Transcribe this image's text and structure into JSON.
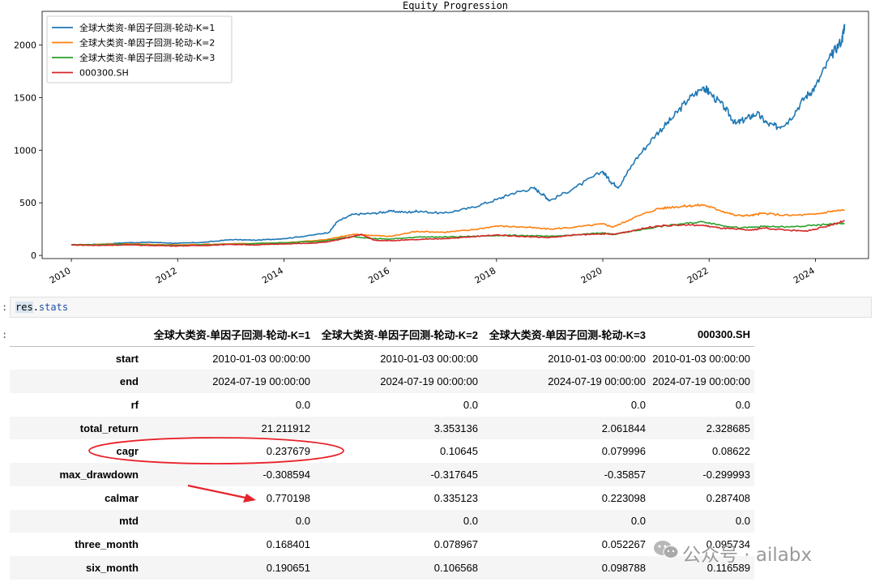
{
  "chart_data": {
    "type": "line",
    "title": "Equity Progression",
    "xlim": [
      2009.45,
      2025.0
    ],
    "ylim": [
      -30,
      2320
    ],
    "yticks": [
      0,
      500,
      1000,
      1500,
      2000
    ],
    "xticks": [
      2010,
      2012,
      2014,
      2016,
      2018,
      2020,
      2022,
      2024
    ],
    "legend": "top-left",
    "grid": false,
    "series": [
      {
        "name": "全球大类资-单因子回测-轮动-K=1",
        "color": "#1f77b4",
        "points": [
          [
            2010.0,
            100
          ],
          [
            2010.5,
            105
          ],
          [
            2011.0,
            120
          ],
          [
            2011.5,
            125
          ],
          [
            2012.0,
            115
          ],
          [
            2012.5,
            125
          ],
          [
            2013.0,
            150
          ],
          [
            2013.5,
            145
          ],
          [
            2014.0,
            160
          ],
          [
            2014.5,
            190
          ],
          [
            2014.85,
            220
          ],
          [
            2015.0,
            320
          ],
          [
            2015.3,
            390
          ],
          [
            2015.7,
            400
          ],
          [
            2016.0,
            420
          ],
          [
            2016.3,
            410
          ],
          [
            2016.5,
            420
          ],
          [
            2017.0,
            400
          ],
          [
            2017.5,
            450
          ],
          [
            2018.0,
            530
          ],
          [
            2018.3,
            590
          ],
          [
            2018.7,
            640
          ],
          [
            2018.9,
            570
          ],
          [
            2019.0,
            520
          ],
          [
            2019.5,
            650
          ],
          [
            2020.0,
            800
          ],
          [
            2020.15,
            700
          ],
          [
            2020.3,
            650
          ],
          [
            2020.6,
            900
          ],
          [
            2021.0,
            1150
          ],
          [
            2021.3,
            1300
          ],
          [
            2021.6,
            1480
          ],
          [
            2021.9,
            1600
          ],
          [
            2022.0,
            1550
          ],
          [
            2022.3,
            1400
          ],
          [
            2022.5,
            1250
          ],
          [
            2022.7,
            1300
          ],
          [
            2022.9,
            1350
          ],
          [
            2023.1,
            1250
          ],
          [
            2023.3,
            1220
          ],
          [
            2023.5,
            1280
          ],
          [
            2023.8,
            1500
          ],
          [
            2024.0,
            1600
          ],
          [
            2024.3,
            1900
          ],
          [
            2024.5,
            2050
          ],
          [
            2024.55,
            2200
          ]
        ]
      },
      {
        "name": "全球大类资-单因子回测-轮动-K=2",
        "color": "#ff7f0e",
        "points": [
          [
            2010.0,
            100
          ],
          [
            2011.0,
            110
          ],
          [
            2012.0,
            100
          ],
          [
            2013.0,
            110
          ],
          [
            2014.0,
            120
          ],
          [
            2014.8,
            150
          ],
          [
            2015.3,
            200
          ],
          [
            2015.7,
            190
          ],
          [
            2016.0,
            180
          ],
          [
            2016.5,
            230
          ],
          [
            2017.0,
            220
          ],
          [
            2017.5,
            240
          ],
          [
            2018.0,
            280
          ],
          [
            2018.5,
            270
          ],
          [
            2019.0,
            250
          ],
          [
            2019.5,
            270
          ],
          [
            2020.0,
            300
          ],
          [
            2020.2,
            270
          ],
          [
            2020.5,
            340
          ],
          [
            2021.0,
            440
          ],
          [
            2021.3,
            460
          ],
          [
            2021.6,
            470
          ],
          [
            2021.9,
            480
          ],
          [
            2022.2,
            430
          ],
          [
            2022.5,
            380
          ],
          [
            2022.8,
            380
          ],
          [
            2023.0,
            400
          ],
          [
            2023.5,
            380
          ],
          [
            2024.0,
            390
          ],
          [
            2024.3,
            420
          ],
          [
            2024.55,
            430
          ]
        ]
      },
      {
        "name": "全球大类资-单因子回测-轮动-K=3",
        "color": "#2ca02c",
        "points": [
          [
            2010.0,
            100
          ],
          [
            2011.0,
            105
          ],
          [
            2012.0,
            95
          ],
          [
            2013.0,
            105
          ],
          [
            2014.0,
            120
          ],
          [
            2014.8,
            140
          ],
          [
            2015.3,
            180
          ],
          [
            2015.7,
            160
          ],
          [
            2016.0,
            155
          ],
          [
            2016.5,
            175
          ],
          [
            2017.0,
            175
          ],
          [
            2017.5,
            180
          ],
          [
            2018.0,
            190
          ],
          [
            2018.5,
            190
          ],
          [
            2019.0,
            180
          ],
          [
            2019.5,
            195
          ],
          [
            2020.0,
            215
          ],
          [
            2020.2,
            200
          ],
          [
            2020.5,
            225
          ],
          [
            2021.0,
            270
          ],
          [
            2021.5,
            300
          ],
          [
            2021.9,
            320
          ],
          [
            2022.2,
            290
          ],
          [
            2022.6,
            260
          ],
          [
            2023.0,
            275
          ],
          [
            2023.5,
            270
          ],
          [
            2024.0,
            285
          ],
          [
            2024.3,
            300
          ],
          [
            2024.55,
            305
          ]
        ]
      },
      {
        "name": "000300.SH",
        "color": "#d62728",
        "points": [
          [
            2010.0,
            100
          ],
          [
            2010.5,
            95
          ],
          [
            2011.0,
            100
          ],
          [
            2011.5,
            95
          ],
          [
            2012.0,
            90
          ],
          [
            2012.5,
            95
          ],
          [
            2013.0,
            105
          ],
          [
            2013.5,
            100
          ],
          [
            2014.0,
            110
          ],
          [
            2014.5,
            115
          ],
          [
            2014.85,
            130
          ],
          [
            2015.3,
            180
          ],
          [
            2015.45,
            200
          ],
          [
            2015.7,
            145
          ],
          [
            2016.0,
            140
          ],
          [
            2016.5,
            150
          ],
          [
            2017.0,
            160
          ],
          [
            2017.5,
            175
          ],
          [
            2018.0,
            195
          ],
          [
            2018.5,
            180
          ],
          [
            2019.0,
            170
          ],
          [
            2019.5,
            195
          ],
          [
            2020.0,
            205
          ],
          [
            2020.2,
            200
          ],
          [
            2020.6,
            240
          ],
          [
            2021.0,
            280
          ],
          [
            2021.5,
            290
          ],
          [
            2021.9,
            285
          ],
          [
            2022.2,
            260
          ],
          [
            2022.5,
            250
          ],
          [
            2022.8,
            240
          ],
          [
            2023.0,
            260
          ],
          [
            2023.5,
            240
          ],
          [
            2023.8,
            230
          ],
          [
            2024.0,
            250
          ],
          [
            2024.3,
            290
          ],
          [
            2024.55,
            330
          ]
        ]
      }
    ]
  },
  "code_cell": {
    "prompt": ":",
    "code_obj": "res",
    "code_dot": ".",
    "code_attr": "stats"
  },
  "output_prompt": ":",
  "table": {
    "columns": [
      "全球大类资-单因子回测-轮动-K=1",
      "全球大类资-单因子回测-轮动-K=2",
      "全球大类资-单因子回测-轮动-K=3",
      "000300.SH"
    ],
    "rows": [
      {
        "label": "start",
        "values": [
          "2010-01-03 00:00:00",
          "2010-01-03 00:00:00",
          "2010-01-03 00:00:00",
          "2010-01-03 00:00:00"
        ]
      },
      {
        "label": "end",
        "values": [
          "2024-07-19 00:00:00",
          "2024-07-19 00:00:00",
          "2024-07-19 00:00:00",
          "2024-07-19 00:00:00"
        ]
      },
      {
        "label": "rf",
        "values": [
          "0.0",
          "0.0",
          "0.0",
          "0.0"
        ]
      },
      {
        "label": "total_return",
        "values": [
          "21.211912",
          "3.353136",
          "2.061844",
          "2.328685"
        ]
      },
      {
        "label": "cagr",
        "values": [
          "0.237679",
          "0.10645",
          "0.079996",
          "0.08622"
        ]
      },
      {
        "label": "max_drawdown",
        "values": [
          "-0.308594",
          "-0.317645",
          "-0.35857",
          "-0.299993"
        ]
      },
      {
        "label": "calmar",
        "values": [
          "0.770198",
          "0.335123",
          "0.223098",
          "0.287408"
        ]
      },
      {
        "label": "mtd",
        "values": [
          "0.0",
          "0.0",
          "0.0",
          "0.0"
        ]
      },
      {
        "label": "three_month",
        "values": [
          "0.168401",
          "0.078967",
          "0.052267",
          "0.095734"
        ]
      },
      {
        "label": "six_month",
        "values": [
          "0.190651",
          "0.106568",
          "0.098788",
          "0.116589"
        ]
      }
    ]
  },
  "watermark": {
    "text": "公众号 · ailabx",
    "icon": "wechat-icon"
  },
  "annotation_color": "#e8232a"
}
